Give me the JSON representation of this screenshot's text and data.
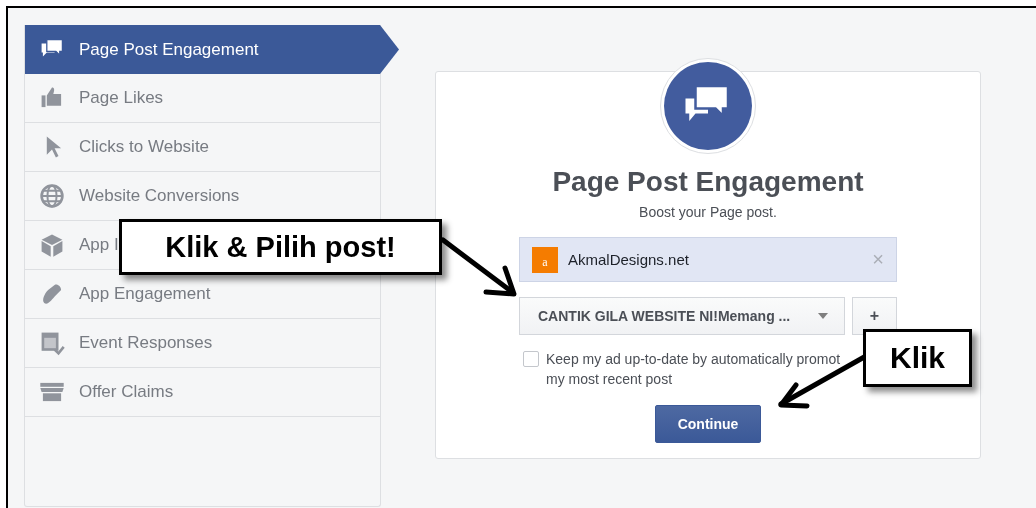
{
  "sidebar": {
    "items": [
      {
        "label": "Page Post Engagement",
        "selected": true
      },
      {
        "label": "Page Likes",
        "selected": false
      },
      {
        "label": "Clicks to Website",
        "selected": false
      },
      {
        "label": "Website Conversions",
        "selected": false
      },
      {
        "label": "App I",
        "selected": false
      },
      {
        "label": "App Engagement",
        "selected": false
      },
      {
        "label": "Event Responses",
        "selected": false
      },
      {
        "label": "Offer Claims",
        "selected": false
      }
    ]
  },
  "card": {
    "title": "Page Post Engagement",
    "subtitle": "Boost your Page post.",
    "page": {
      "avatar_letter": "a",
      "name": "AkmalDesigns.net",
      "remove": "×"
    },
    "post_dropdown": {
      "value": "CANTIK GILA WEBSITE NI!Memang ..."
    },
    "add_button": "+",
    "keep_updated": {
      "checked": false,
      "lines": [
        "Keep my ad up-to-date by automatically promot",
        "my most recent post"
      ]
    },
    "continue_button": "Continue"
  },
  "annotations": [
    {
      "text": "Klik & Pilih post!"
    },
    {
      "text": "Klik"
    }
  ]
}
